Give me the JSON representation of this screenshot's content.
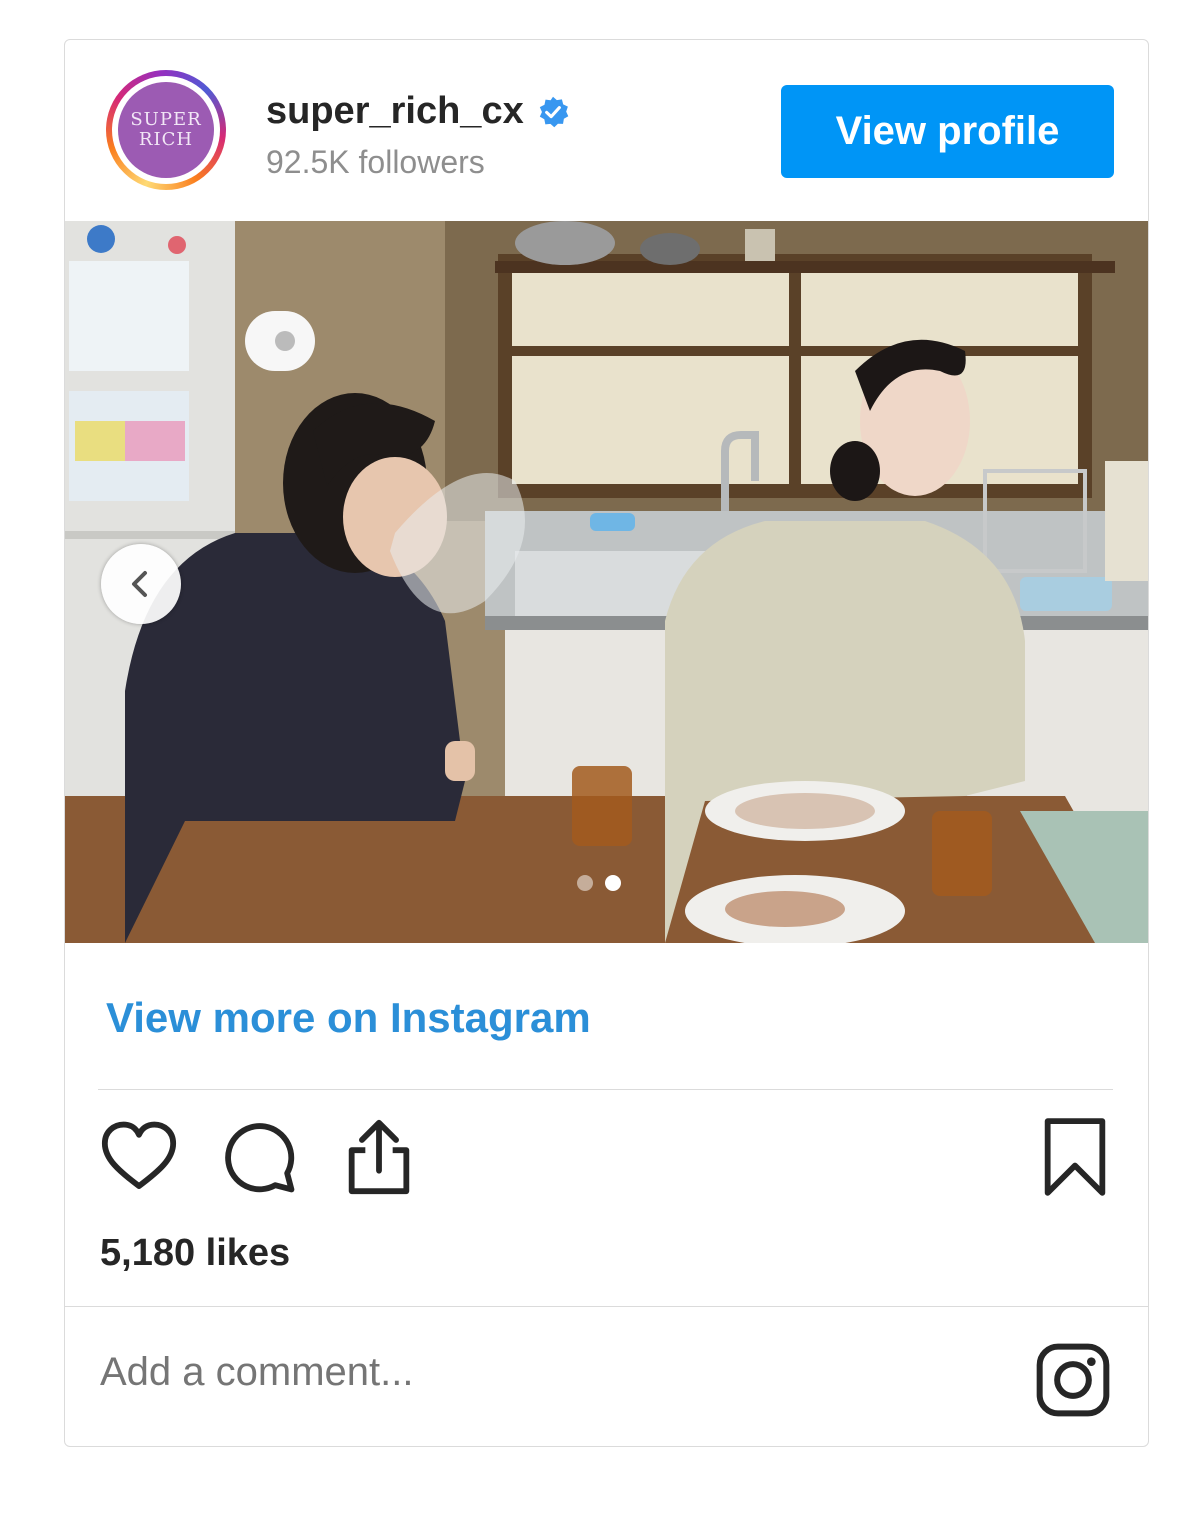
{
  "account": {
    "avatar_line1": "SUPER",
    "avatar_line2": "RICH",
    "username": "super_rich_cx",
    "verified_icon": "verified-badge-icon",
    "followers": "92.5K followers"
  },
  "header": {
    "view_profile_label": "View profile"
  },
  "post": {
    "carousel": {
      "current": 2,
      "total": 2
    },
    "view_more_label": "View more on Instagram",
    "likes": "5,180 likes",
    "comment_placeholder": "Add a comment..."
  },
  "icons": {
    "like": "heart-icon",
    "comment": "comment-icon",
    "share": "share-icon",
    "save": "bookmark-icon",
    "brand": "instagram-icon",
    "prev": "chevron-left-icon"
  },
  "colors": {
    "accent": "#0095f6",
    "link": "#2b8fd8",
    "verified": "#3897f0",
    "text": "#262626",
    "muted": "#8e8e8e"
  }
}
